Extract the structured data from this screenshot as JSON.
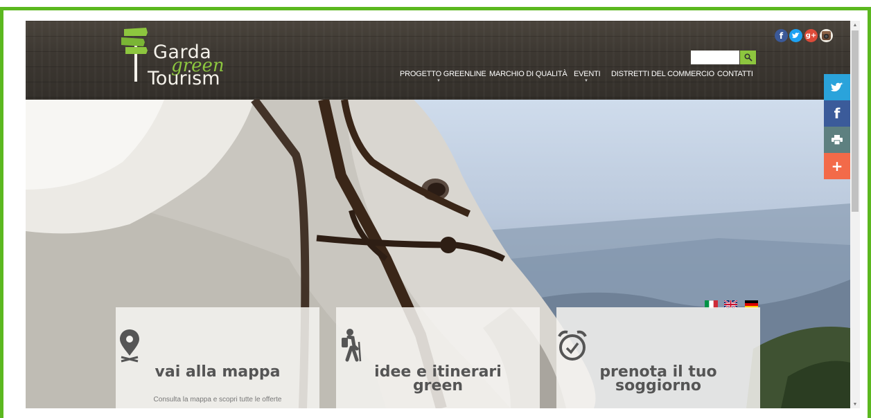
{
  "brand": {
    "logo_line1": "Garda",
    "logo_line2": "green",
    "logo_line3": "Tourism"
  },
  "header": {
    "nav": [
      {
        "label": "PROGETTO GREENLINE",
        "has_submenu": true
      },
      {
        "label": "MARCHIO DI QUALITÀ",
        "has_submenu": false
      },
      {
        "label": "EVENTI",
        "has_submenu": true
      },
      {
        "label": "DISTRETTI DEL COMMERCIO",
        "has_submenu": false
      },
      {
        "label": "CONTATTI",
        "has_submenu": false
      }
    ],
    "search": {
      "placeholder": "",
      "value": "",
      "button_icon": "search-icon"
    },
    "social_icons": [
      "facebook-icon",
      "twitter-icon",
      "google-plus-icon",
      "instagram-icon"
    ]
  },
  "languages": [
    "it-flag-icon",
    "en-flag-icon",
    "de-flag-icon"
  ],
  "cards": [
    {
      "icon": "map-pin-icon",
      "title": "vai alla mappa",
      "text": "Consulta la mappa e scopri tutte le offerte"
    },
    {
      "icon": "hiker-icon",
      "title_line1": "idee e itinerari",
      "title_line2": "green"
    },
    {
      "icon": "alarm-clock-icon",
      "title_line1": "prenota il tuo",
      "title_line2": "soggiorno"
    }
  ],
  "share_bar": [
    {
      "icon": "twitter-icon",
      "color": "#2aa3db"
    },
    {
      "icon": "facebook-icon",
      "color": "#3b5b9a"
    },
    {
      "icon": "print-icon",
      "color": "#5e8080"
    },
    {
      "icon": "plus-icon",
      "color": "#f36a49"
    }
  ],
  "colors": {
    "frame": "#5bb81f",
    "accent_green": "#8dc63f",
    "header_wood": "#3d3832"
  }
}
